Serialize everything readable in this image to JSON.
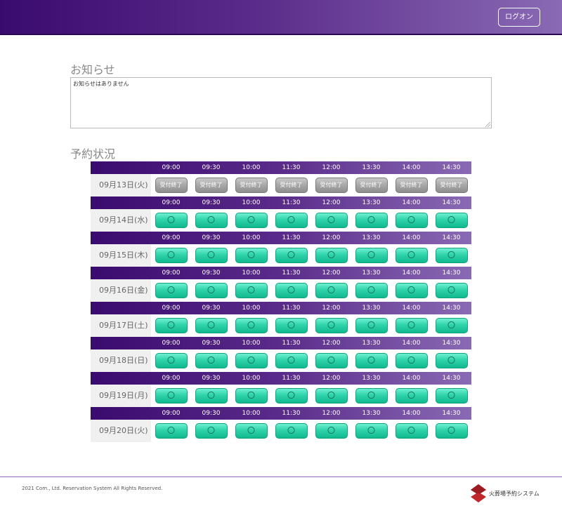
{
  "header": {
    "logon_label": "ログオン"
  },
  "notice": {
    "title": "お知らせ",
    "text": "お知らせはありません"
  },
  "reservation": {
    "title": "予約状況",
    "times": [
      "09:00",
      "09:30",
      "10:00",
      "11:30",
      "12:00",
      "13:30",
      "14:00",
      "14:30"
    ],
    "open_mark": "〇",
    "closed_label": "受付終了",
    "days": [
      {
        "date": "09月13日(火)",
        "status": "closed"
      },
      {
        "date": "09月14日(水)",
        "status": "open"
      },
      {
        "date": "09月15日(木)",
        "status": "open"
      },
      {
        "date": "09月16日(金)",
        "status": "open"
      },
      {
        "date": "09月17日(土)",
        "status": "open"
      },
      {
        "date": "09月18日(日)",
        "status": "open"
      },
      {
        "date": "09月19日(月)",
        "status": "open"
      },
      {
        "date": "09月20日(火)",
        "status": "open"
      }
    ]
  },
  "footer": {
    "copyright": "2021 Com., Ltd. Reservation System All Rights Reserved.",
    "brand": "火葬場予約システム"
  },
  "colors": {
    "open": "#2fd3ab",
    "closed": "#a7a7a7",
    "header": "#3a0b6e"
  }
}
